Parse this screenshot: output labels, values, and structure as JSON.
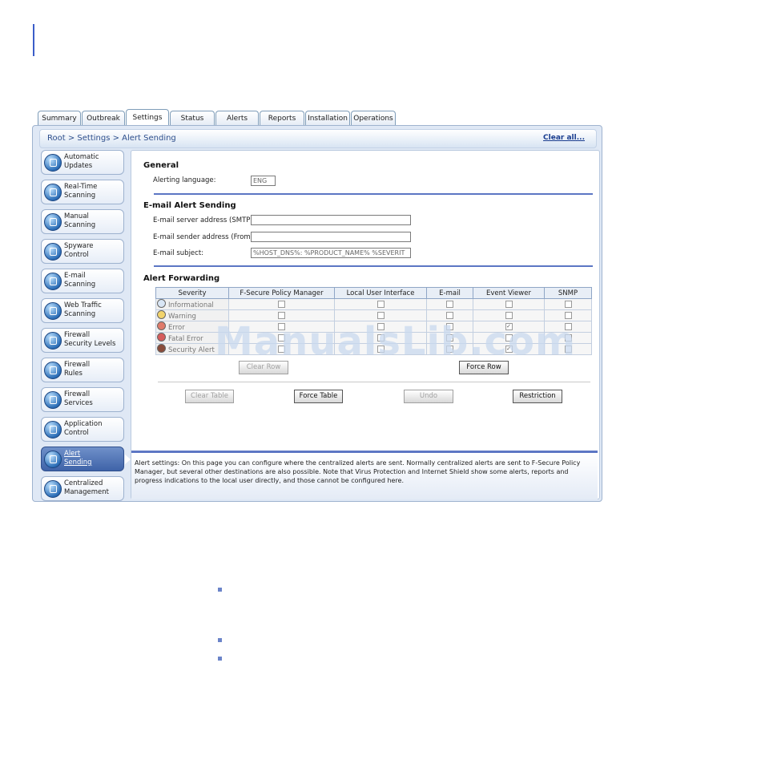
{
  "tabs": [
    "Summary",
    "Outbreak",
    "Settings",
    "Status",
    "Alerts",
    "Reports",
    "Installation",
    "Operations"
  ],
  "active_tab": "Settings",
  "breadcrumb": "Root > Settings > Alert Sending",
  "clear_all": "Clear all...",
  "sidebar": [
    {
      "label": "Automatic\nUpdates",
      "icon": "automatic-updates-icon"
    },
    {
      "label": "Real-Time\nScanning",
      "icon": "real-time-scanning-icon"
    },
    {
      "label": "Manual\nScanning",
      "icon": "manual-scanning-icon"
    },
    {
      "label": "Spyware\nControl",
      "icon": "spyware-control-icon"
    },
    {
      "label": "E-mail\nScanning",
      "icon": "email-scanning-icon"
    },
    {
      "label": "Web Traffic\nScanning",
      "icon": "web-traffic-scanning-icon"
    },
    {
      "label": "Firewall\nSecurity Levels",
      "icon": "firewall-security-levels-icon"
    },
    {
      "label": "Firewall\nRules",
      "icon": "firewall-rules-icon"
    },
    {
      "label": "Firewall\nServices",
      "icon": "firewall-services-icon"
    },
    {
      "label": "Application\nControl",
      "icon": "application-control-icon"
    },
    {
      "label": "Alert\nSending",
      "icon": "alert-sending-icon"
    },
    {
      "label": "Centralized\nManagement",
      "icon": "centralized-management-icon"
    }
  ],
  "active_sidebar": 10,
  "general": {
    "title": "General",
    "language_label": "Alerting language:",
    "language_value": "ENG"
  },
  "email": {
    "title": "E-mail Alert Sending",
    "server_label": "E-mail server address (SMTP):",
    "server_value": "",
    "sender_label": "E-mail sender address (From):",
    "sender_value": "",
    "subject_label": "E-mail subject:",
    "subject_value": "%HOST_DNS%: %PRODUCT_NAME% %SEVERIT"
  },
  "forwarding": {
    "title": "Alert Forwarding",
    "columns": [
      "Severity",
      "F-Secure Policy Manager",
      "Local User Interface",
      "E-mail",
      "Event Viewer",
      "SNMP"
    ],
    "rows": [
      {
        "severity": "Informational",
        "icon": "info-icon",
        "checks": [
          false,
          false,
          false,
          false,
          false
        ]
      },
      {
        "severity": "Warning",
        "icon": "warning-icon",
        "checks": [
          false,
          false,
          false,
          false,
          false
        ]
      },
      {
        "severity": "Error",
        "icon": "error-icon",
        "checks": [
          false,
          false,
          false,
          true,
          false
        ]
      },
      {
        "severity": "Fatal Error",
        "icon": "fatal-error-icon",
        "checks": [
          false,
          false,
          false,
          false,
          false
        ]
      },
      {
        "severity": "Security Alert",
        "icon": "security-alert-icon",
        "checks": [
          false,
          false,
          false,
          true,
          false
        ]
      }
    ],
    "clear_row": "Clear Row",
    "force_row": "Force Row"
  },
  "buttons": {
    "clear_table": "Clear Table",
    "force_table": "Force Table",
    "undo": "Undo",
    "restriction": "Restriction"
  },
  "help_text": "Alert settings: On this page you can configure where the centralized alerts are sent. Normally centralized alerts are sent to F-Secure Policy Manager, but several other destinations are also possible. Note that Virus Protection and Internet Shield show some alerts, reports and progress indications to the local user directly, and those cannot be configured here.",
  "watermark": "ManualsLib.com",
  "colors": {
    "accent": "#5c76c4",
    "nav_active": "#3f63a8",
    "breadcrumb": "#2e4f8c"
  }
}
